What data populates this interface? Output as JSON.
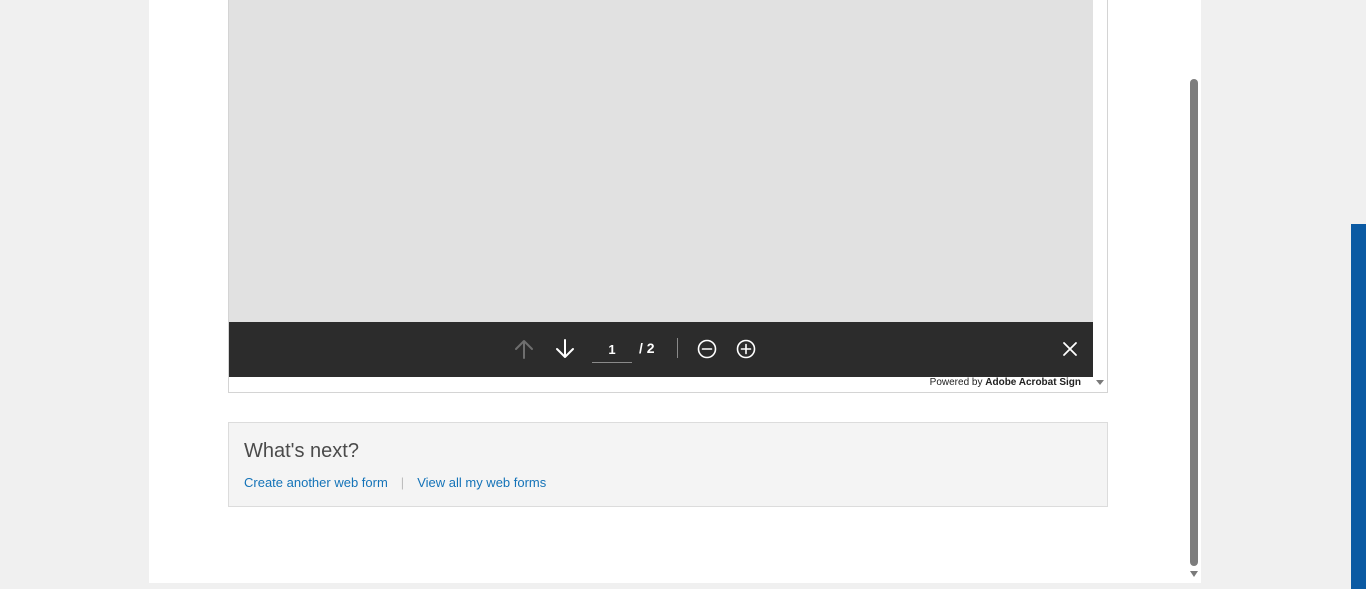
{
  "viewer": {
    "current_page": "1",
    "page_total": "/ 2",
    "powered_prefix": "Powered by",
    "powered_brand": "Adobe Acrobat Sign",
    "icons": {
      "prev": "arrow-up-icon",
      "next": "arrow-down-icon",
      "zoom_out": "zoom-out-icon",
      "zoom_in": "zoom-in-icon",
      "close": "close-icon"
    }
  },
  "next_section": {
    "title": "What's next?",
    "links": {
      "create": "Create another web form",
      "separator": "|",
      "view_all": "View all my web forms"
    }
  },
  "colors": {
    "toolbar": "#2c2c2c",
    "document_area": "#e1e1e1",
    "link": "#1473b8",
    "side_tab": "#0b5aa3"
  }
}
